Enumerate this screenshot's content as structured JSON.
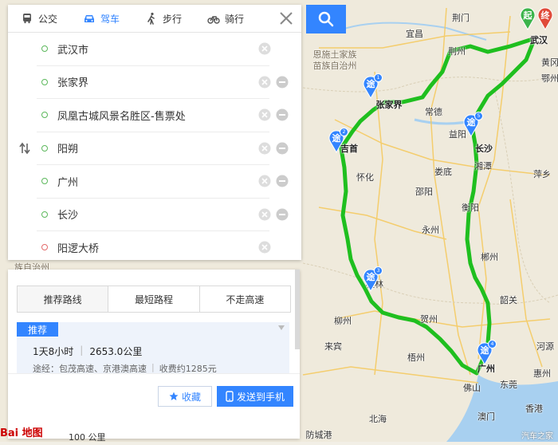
{
  "transport_tabs": [
    {
      "label": "公交",
      "icon": "bus-icon"
    },
    {
      "label": "驾车",
      "icon": "car-icon"
    },
    {
      "label": "步行",
      "icon": "walk-icon"
    },
    {
      "label": "骑行",
      "icon": "bicycle-icon"
    }
  ],
  "active_tab": "驾车",
  "waypoints": [
    {
      "text": "武汉市",
      "type": "start"
    },
    {
      "text": "张家界",
      "type": "via"
    },
    {
      "text": "凤凰古城风景名胜区-售票处",
      "type": "via"
    },
    {
      "text": "阳朔",
      "type": "via"
    },
    {
      "text": "广州",
      "type": "via"
    },
    {
      "text": "长沙",
      "type": "via"
    },
    {
      "text": "阳逻大桥",
      "type": "end"
    }
  ],
  "route_tabs": [
    "推荐路线",
    "最短路程",
    "不走高速"
  ],
  "route": {
    "badge": "推荐",
    "duration": "1天8小时",
    "distance": "2653.0公里",
    "via": "途经：包茂高速、京港澳高速",
    "toll": "收费约1285元"
  },
  "buttons": {
    "favorite": "收藏",
    "send_to_phone": "发送到手机"
  },
  "markers": {
    "start": "起",
    "end": "终",
    "via": "途"
  },
  "map_labels": [
    "荆门",
    "宜昌",
    "荆州",
    "恩施土家族",
    "苗族自治州",
    "常德",
    "张家界",
    "益阳",
    "长沙",
    "吉首",
    "怀化",
    "湘潭",
    "娄底",
    "萍乡",
    "邵阳",
    "衡阳",
    "永州",
    "郴州",
    "韶关",
    "桂林",
    "柳州",
    "贺州",
    "来宾",
    "梧州",
    "广州",
    "惠州",
    "河源",
    "东莞",
    "佛山",
    "澳门",
    "香港",
    "防城港",
    "北海",
    "武汉",
    "黄冈",
    "鄂州",
    "族自治州"
  ],
  "scale": "100 公里",
  "logo": "Bai 地图",
  "watermark": "汽车之家",
  "colors": {
    "accent": "#3385ff",
    "route": "#1fbf1f",
    "start": "#3cb44b",
    "end": "#e04b3a"
  }
}
